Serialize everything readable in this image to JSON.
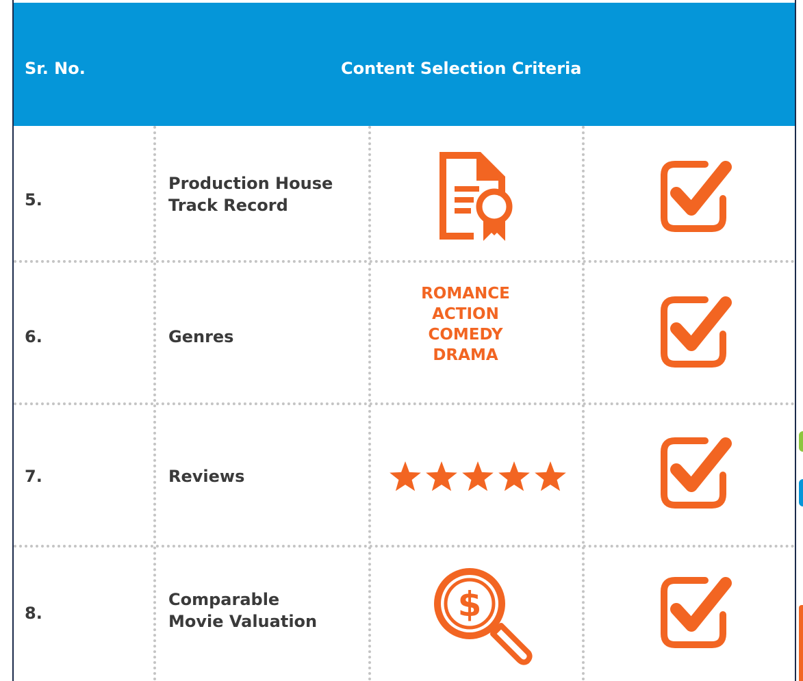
{
  "header": {
    "sr_no_label": "Sr. No.",
    "criteria_label": "Content Selection Criteria",
    "background_color": "#0596d9"
  },
  "accent_color": "#f26522",
  "rows": [
    {
      "number": "5.",
      "criterion_line1": "Production House",
      "criterion_line2": "Track Record",
      "icon": "certificate-icon",
      "status_icon": "checkbox-checked-icon"
    },
    {
      "number": "6.",
      "criterion_line1": "Genres",
      "criterion_line2": "",
      "genres": [
        "ROMANCE",
        "ACTION",
        "COMEDY",
        "DRAMA"
      ],
      "status_icon": "checkbox-checked-icon"
    },
    {
      "number": "7.",
      "criterion_line1": "Reviews",
      "criterion_line2": "",
      "icon": "five-stars-icon",
      "rating": 5,
      "rating_max": 5,
      "status_icon": "checkbox-checked-icon"
    },
    {
      "number": "8.",
      "criterion_line1": "Comparable",
      "criterion_line2": "Movie Valuation",
      "icon": "dollar-magnifier-icon",
      "status_icon": "checkbox-checked-icon"
    }
  ]
}
